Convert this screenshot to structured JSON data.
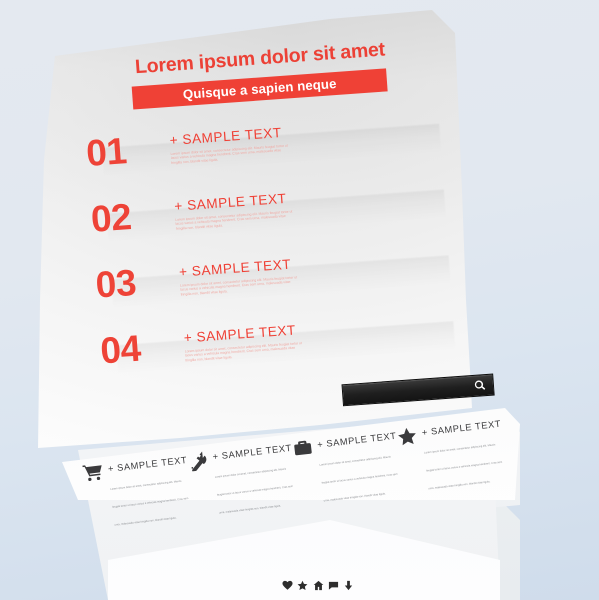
{
  "background": {
    "top_color": "#e4e9f0",
    "bottom_color": "#cfdceb"
  },
  "theme": {
    "accent_red": "#ef4136",
    "dark": "#1f1f1f",
    "icon_gray": "#3a3a3c"
  },
  "card": {
    "title": "Lorem ipsum dolor sit amet",
    "subtitle": "Quisque a sapien neque",
    "rows": [
      {
        "number": "01",
        "title": "+ SAMPLE TEXT",
        "body": "Lorem ipsum dolor sit amet, consectetur adipiscing elit. Mauris feugiat tortor ut lacus varius a vehicula magna hendrerit. Cras sem urna, malesuada vitae fringilla non, blandit vitae ligula."
      },
      {
        "number": "02",
        "title": "+ SAMPLE TEXT",
        "body": "Lorem ipsum dolor sit amet, consectetur adipiscing elit. Mauris feugiat tortor ut lacus varius a vehicula magna hendrerit. Cras sem urna, malesuada vitae fringilla non, blandit vitae ligula."
      },
      {
        "number": "03",
        "title": "+ SAMPLE TEXT",
        "body": "Lorem ipsum dolor sit amet, consectetur adipiscing elit. Mauris feugiat tortor ut lacus varius a vehicula magna hendrerit. Cras sem urna, malesuada vitae fringilla non, blandit vitae ligula."
      },
      {
        "number": "04",
        "title": "+ SAMPLE TEXT",
        "body": "Lorem ipsum dolor sit amet, consectetur adipiscing elit. Mauris feugiat tortor ut lacus varius a vehicula magna hendrerit. Cras sem urna, malesuada vitae fringilla non, blandit vitae ligula."
      }
    ]
  },
  "search": {
    "value": "",
    "placeholder": "",
    "icon": "search-icon"
  },
  "features": [
    {
      "icon": "shopping-cart-icon",
      "title": "+ SAMPLE TEXT",
      "body": "Lorem ipsum dolor sit amet, consectetur adipiscing elit. Mauris feugiat tortor ut lacus varius a vehicula magna hendrerit. Cras sem urna, malesuada vitae fringilla non, blandit vitae ligula."
    },
    {
      "icon": "wrench-icon",
      "title": "+ SAMPLE TEXT",
      "body": "Lorem ipsum dolor sit amet, consectetur adipiscing elit. Mauris feugiat tortor ut lacus varius a vehicula magna hendrerit. Cras sem urna, malesuada vitae fringilla non, blandit vitae ligula."
    },
    {
      "icon": "briefcase-icon",
      "title": "+ SAMPLE TEXT",
      "body": "Lorem ipsum dolor sit amet, consectetur adipiscing elit. Mauris feugiat tortor ut lacus varius a vehicula magna hendrerit. Cras sem urna, malesuada vitae fringilla non, blandit vitae ligula."
    },
    {
      "icon": "star-icon",
      "title": "+ SAMPLE TEXT",
      "body": "Lorem ipsum dolor sit amet, consectetur adipiscing elit. Mauris feugiat tortor ut lacus varius a vehicula magna hendrerit. Cras sem urna, malesuada vitae fringilla non, blandit vitae ligula."
    }
  ],
  "social_icons": [
    "heart-icon",
    "star-icon",
    "home-icon",
    "speech-bubble-icon",
    "download-arrow-icon"
  ]
}
